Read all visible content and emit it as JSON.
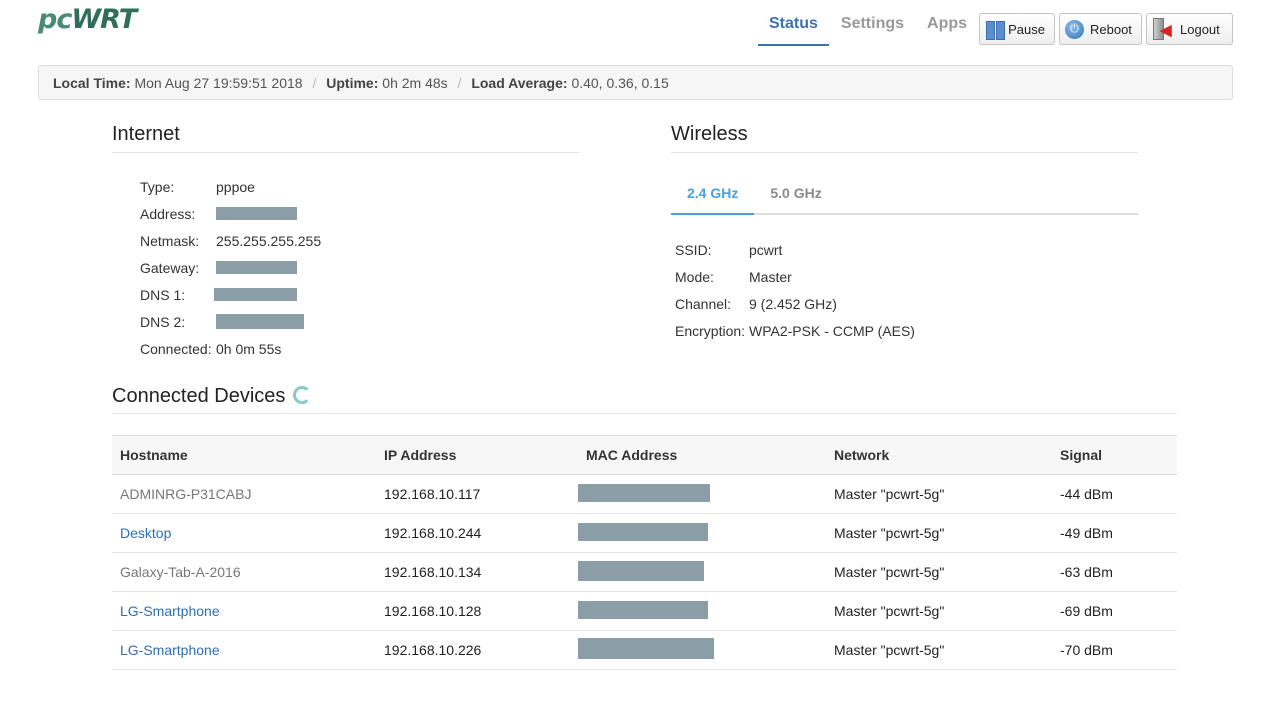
{
  "logo": {
    "part1": "pc",
    "part2": "WRT"
  },
  "nav": {
    "status": "Status",
    "settings": "Settings",
    "apps": "Apps"
  },
  "buttons": {
    "pause": "Pause",
    "reboot": "Reboot",
    "logout": "Logout"
  },
  "statusbar": {
    "local_time_label": "Local Time:",
    "local_time": "Mon Aug 27 19:59:51 2018",
    "uptime_label": "Uptime:",
    "uptime": "0h 2m 48s",
    "load_label": "Load Average:",
    "load": "0.40, 0.36, 0.15",
    "separator": "/"
  },
  "internet": {
    "title": "Internet",
    "type_label": "Type:",
    "type": "pppoe",
    "address_label": "Address:",
    "netmask_label": "Netmask:",
    "netmask": "255.255.255.255",
    "gateway_label": "Gateway:",
    "dns1_label": "DNS 1:",
    "dns2_label": "DNS 2:",
    "connected_label": "Connected:",
    "connected": "0h 0m 55s"
  },
  "wireless": {
    "title": "Wireless",
    "tabs": [
      "2.4 GHz",
      "5.0 GHz"
    ],
    "ssid_label": "SSID:",
    "ssid": "pcwrt",
    "mode_label": "Mode:",
    "mode": "Master",
    "channel_label": "Channel:",
    "channel": "9 (2.452 GHz)",
    "encryption_label": "Encryption:",
    "encryption": "WPA2-PSK - CCMP (AES)"
  },
  "devices": {
    "title": "Connected Devices",
    "headers": [
      "Hostname",
      "IP Address",
      "MAC Address",
      "Network",
      "Signal"
    ],
    "rows": [
      {
        "hostname": "ADMINRG-P31CABJ",
        "ip": "192.168.10.117",
        "network": "Master \"pcwrt-5g\"",
        "signal": "-44 dBm"
      },
      {
        "hostname": "Desktop",
        "ip": "192.168.10.244",
        "network": "Master \"pcwrt-5g\"",
        "signal": "-49 dBm"
      },
      {
        "hostname": "Galaxy-Tab-A-2016",
        "ip": "192.168.10.134",
        "network": "Master \"pcwrt-5g\"",
        "signal": "-63 dBm"
      },
      {
        "hostname": "LG-Smartphone",
        "ip": "192.168.10.128",
        "network": "Master \"pcwrt-5g\"",
        "signal": "-69 dBm"
      },
      {
        "hostname": "LG-Smartphone",
        "ip": "192.168.10.226",
        "network": "Master \"pcwrt-5g\"",
        "signal": "-70 dBm"
      }
    ]
  },
  "colors": {
    "brand": "#4a8c73",
    "nav_active": "#3d72b0",
    "tab_active": "#4aa0d8",
    "link": "#2e6fb0"
  },
  "icons": {
    "pause": "pause-icon",
    "reboot": "power-icon",
    "logout": "logout-icon",
    "refresh": "refresh-icon"
  }
}
